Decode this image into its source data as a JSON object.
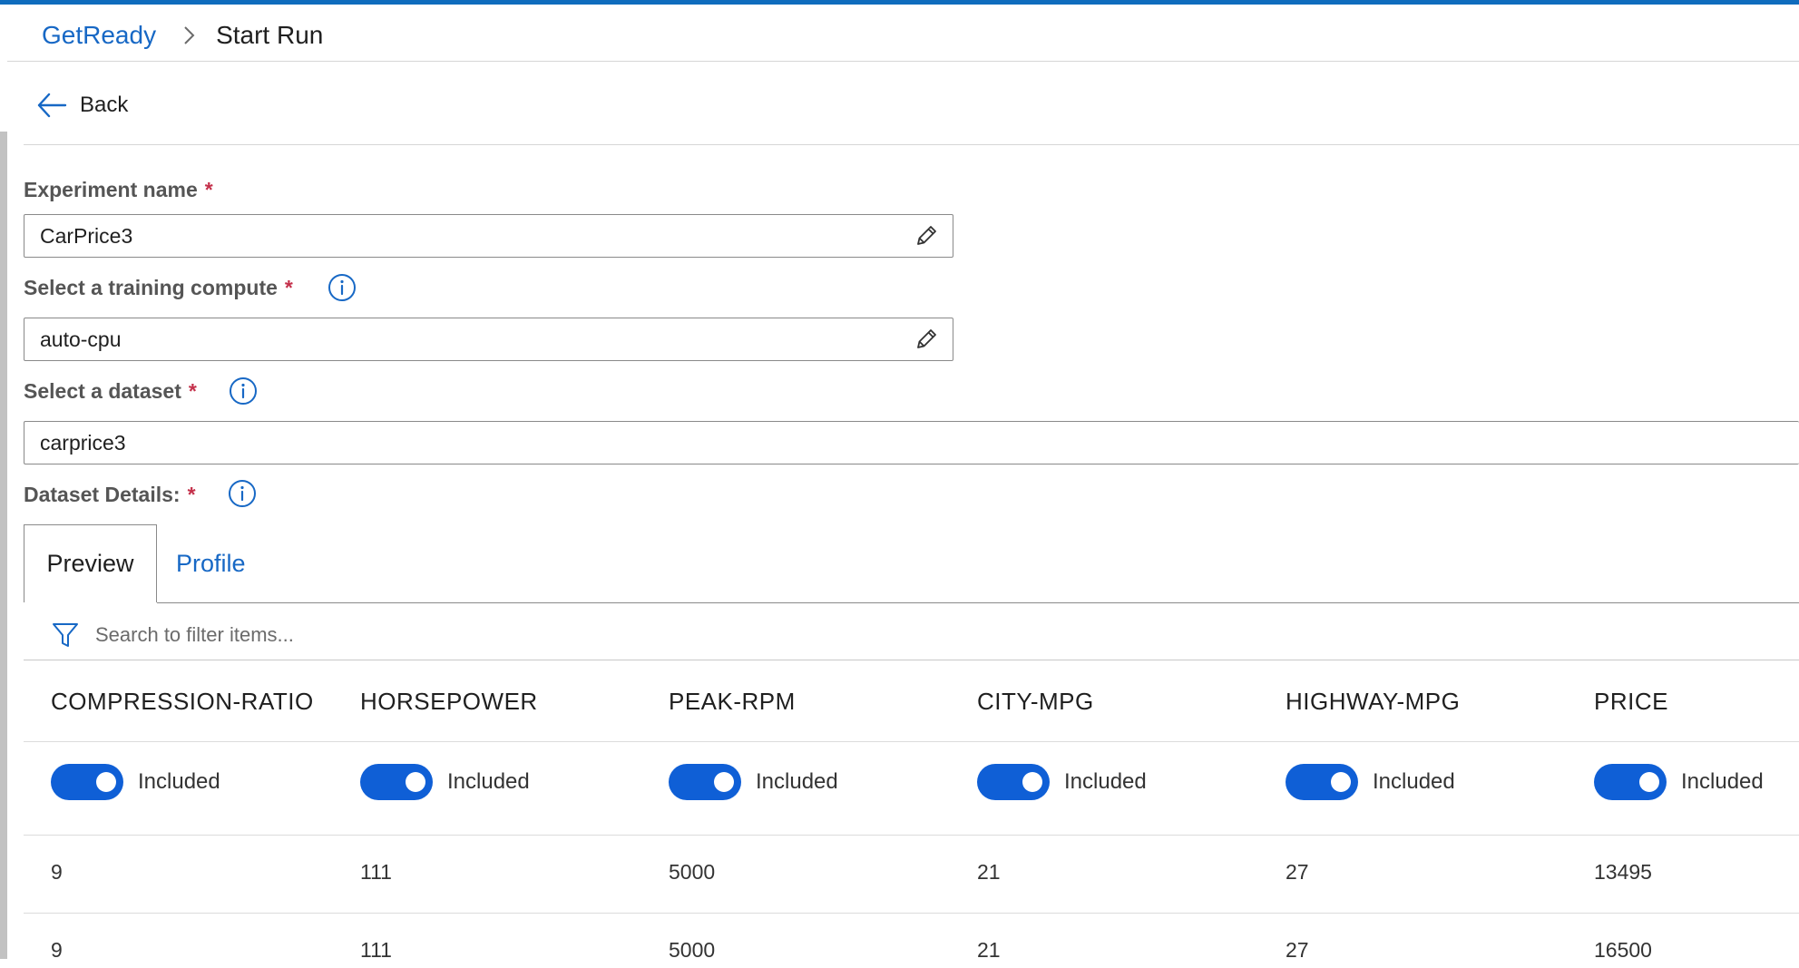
{
  "breadcrumb": {
    "parent": "GetReady",
    "current": "Start Run"
  },
  "back": {
    "label": "Back"
  },
  "experiment": {
    "label": "Experiment name",
    "required": "*",
    "value": "CarPrice3"
  },
  "compute": {
    "label": "Select a training compute",
    "required": "*",
    "value": "auto-cpu"
  },
  "dataset": {
    "label": "Select a dataset",
    "required": "*",
    "value": "carprice3"
  },
  "dataset_details": {
    "label": "Dataset Details:",
    "required": "*"
  },
  "tabs": {
    "preview": "Preview",
    "profile": "Profile",
    "active": "Preview"
  },
  "filter": {
    "placeholder": "Search to filter items..."
  },
  "table": {
    "columns": [
      "COMPRESSION-RATIO",
      "HORSEPOWER",
      "PEAK-RPM",
      "CITY-MPG",
      "HIGHWAY-MPG",
      "PRICE"
    ],
    "toggle_label": "Included",
    "toggles_on": [
      true,
      true,
      true,
      true,
      true,
      true
    ],
    "rows": [
      [
        "9",
        "111",
        "5000",
        "21",
        "27",
        "13495"
      ],
      [
        "9",
        "111",
        "5000",
        "21",
        "27",
        "16500"
      ]
    ]
  },
  "colors": {
    "accent": "#0f6cbd",
    "link": "#1768c5",
    "toggle_on": "#0f5fd6",
    "required": "#c4314b"
  },
  "icons": {
    "chevron": "chevron-right-icon",
    "back": "arrow-left-icon",
    "edit": "pencil-icon",
    "info": "info-icon",
    "filter": "filter-icon"
  }
}
